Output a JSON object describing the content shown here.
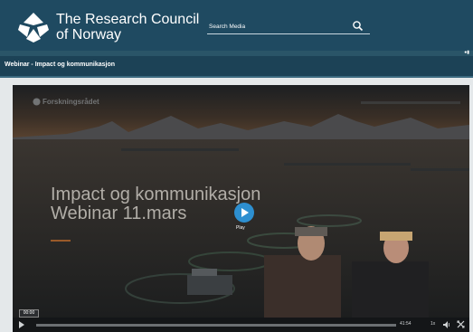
{
  "header": {
    "org_name_line1": "The Research Council",
    "org_name_line2": "of Norway",
    "search_placeholder": "Search Media",
    "search_icon": "search-icon",
    "background": "#1f4a61"
  },
  "page": {
    "title": "Webinar - Impact og kommunikasjon",
    "user_icon": "user-icon"
  },
  "video": {
    "brand": "Forskningsrådet",
    "title_line1": "Impact og kommunikasjon",
    "title_line2": "Webinar 11.mars",
    "play_label": "Play",
    "accent": "#2d8fd0"
  },
  "controls": {
    "current_time": "00:00",
    "duration": "41:54",
    "speed": "1x",
    "progress": 0,
    "volume_icon": "volume-icon",
    "fullscreen_icon": "fullscreen-icon"
  }
}
